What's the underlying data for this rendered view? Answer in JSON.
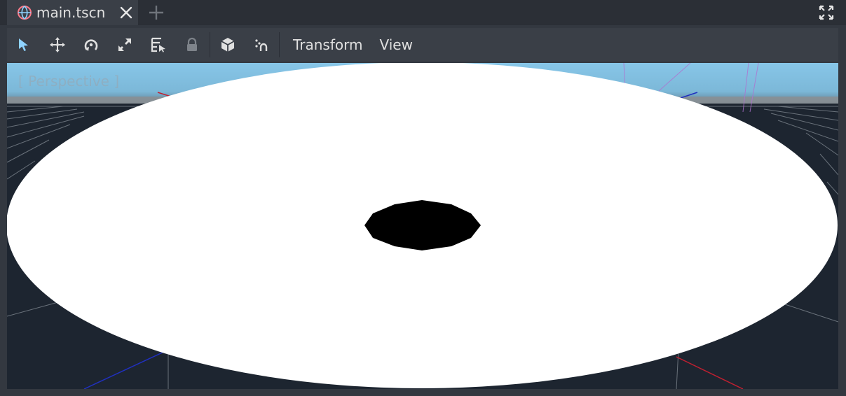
{
  "tabs": [
    {
      "label": "main.tscn",
      "icon": "scene-globe-icon",
      "active": true
    }
  ],
  "toolbar": {
    "tools": [
      {
        "name": "select-tool",
        "icon": "arrow-pointer-icon",
        "active": true
      },
      {
        "name": "move-tool",
        "icon": "move-arrows-icon"
      },
      {
        "name": "rotate-tool",
        "icon": "rotate-icon"
      },
      {
        "name": "scale-tool",
        "icon": "scale-icon"
      },
      {
        "name": "list-select-tool",
        "icon": "list-select-icon"
      },
      {
        "name": "lock-tool",
        "icon": "lock-icon"
      },
      {
        "name": "local-space-tool",
        "icon": "cube-icon"
      },
      {
        "name": "snap-tool",
        "icon": "magnet-snap-icon"
      }
    ],
    "menus": {
      "transform": "Transform",
      "view": "View"
    }
  },
  "viewport": {
    "label": "[ Perspective ]",
    "sky_color": "#87c6e8",
    "ground_color": "#1d2530",
    "disc_color": "#ffffff",
    "hole_color": "#000000"
  },
  "colors": {
    "accent": "#8fd3ff",
    "icon": "#e0e0e0",
    "panel": "#3a3f47",
    "background": "#2b2f36"
  }
}
